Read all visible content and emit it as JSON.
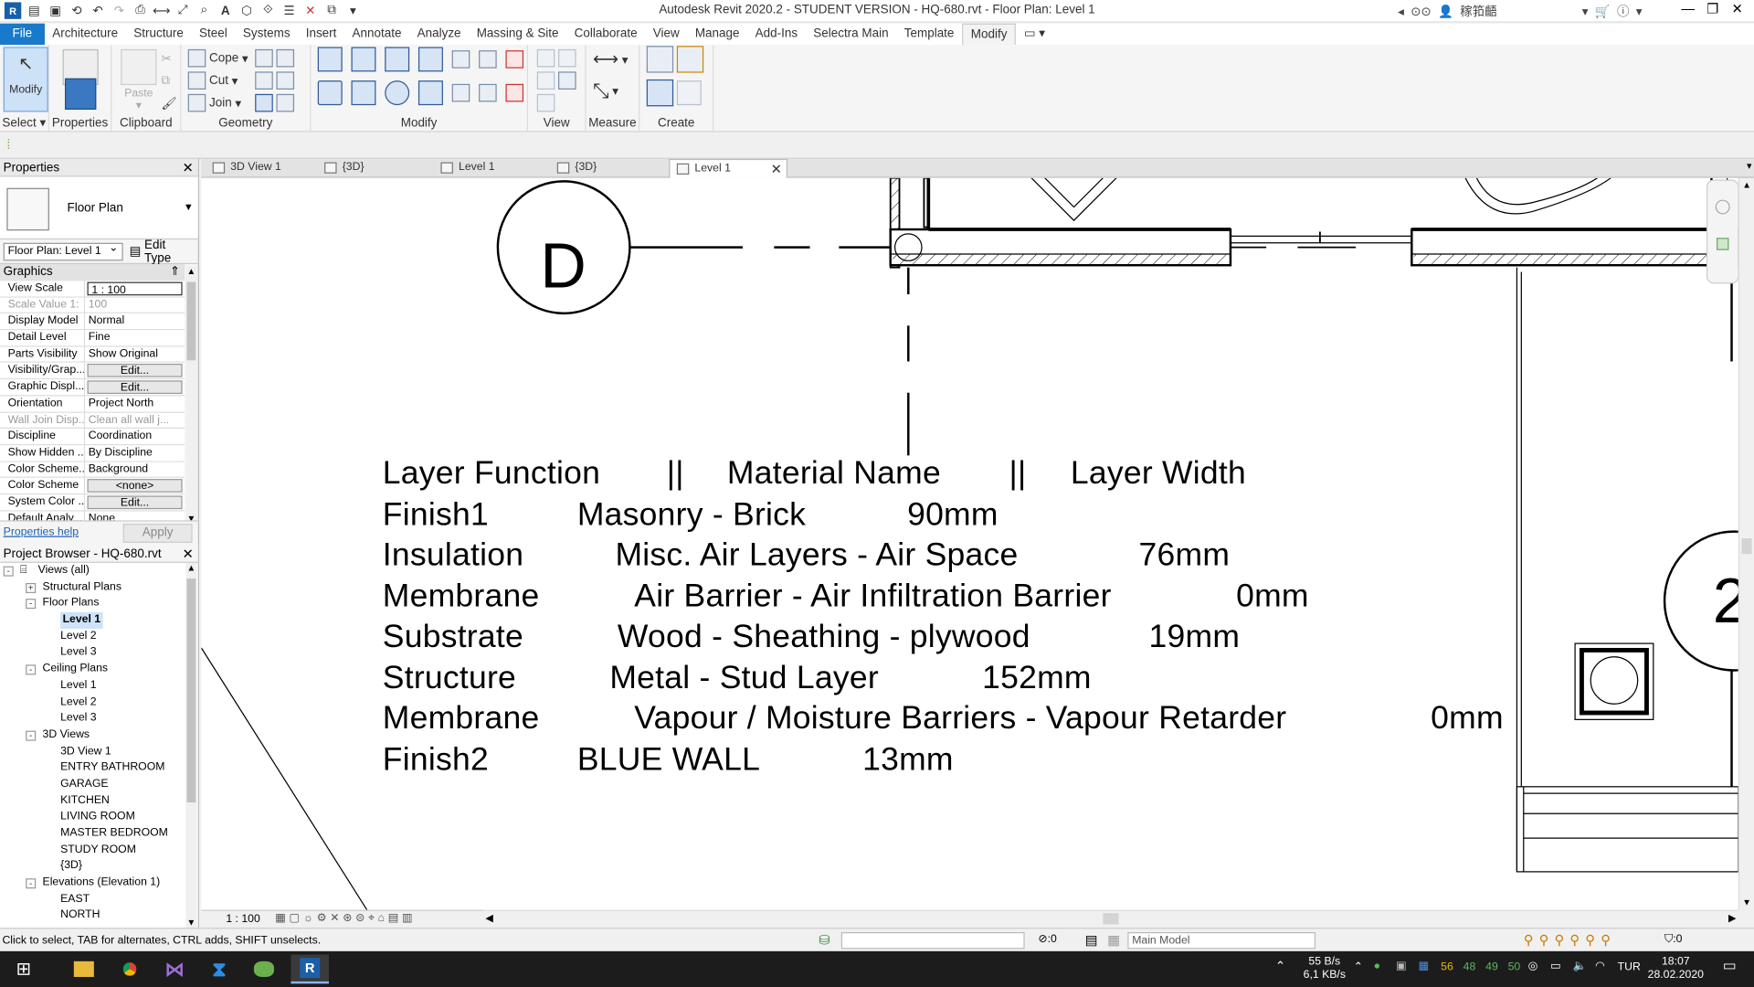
{
  "window": {
    "title": "Autodesk Revit 2020.2 - STUDENT VERSION - HQ-680.rvt - Floor Plan: Level 1",
    "user": "稼筘齬"
  },
  "menu": [
    "File",
    "Architecture",
    "Structure",
    "Steel",
    "Systems",
    "Insert",
    "Annotate",
    "Analyze",
    "Massing & Site",
    "Collaborate",
    "View",
    "Manage",
    "Add-Ins",
    "Selectra Main",
    "Template",
    "Modify"
  ],
  "ribbon": {
    "select": {
      "modify_label": "Modify",
      "panel": "Select"
    },
    "properties": {
      "label": "Properties"
    },
    "clipboard": {
      "paste": "Paste",
      "panel": "Clipboard"
    },
    "geometry": {
      "cope": "Cope",
      "cut": "Cut",
      "join": "Join",
      "panel": "Geometry"
    },
    "modify_panel": "Modify",
    "view_panel": "View",
    "measure_panel": "Measure",
    "create_panel": "Create"
  },
  "properties": {
    "header": "Properties",
    "type_name": "Floor Plan",
    "instance": "Floor Plan: Level 1",
    "edit_type": "Edit Type",
    "section": "Graphics",
    "rows": [
      {
        "name": "View Scale",
        "value": "1 : 100",
        "kind": "input"
      },
      {
        "name": "Scale Value    1:",
        "value": "100",
        "kind": "dim"
      },
      {
        "name": "Display Model",
        "value": "Normal"
      },
      {
        "name": "Detail Level",
        "value": "Fine"
      },
      {
        "name": "Parts Visibility",
        "value": "Show Original"
      },
      {
        "name": "Visibility/Grap...",
        "value": "Edit...",
        "kind": "btn"
      },
      {
        "name": "Graphic Displ...",
        "value": "Edit...",
        "kind": "btn"
      },
      {
        "name": "Orientation",
        "value": "Project North"
      },
      {
        "name": "Wall Join Disp...",
        "value": "Clean all wall j...",
        "kind": "dim"
      },
      {
        "name": "Discipline",
        "value": "Coordination"
      },
      {
        "name": "Show Hidden ...",
        "value": "By Discipline"
      },
      {
        "name": "Color Scheme...",
        "value": "Background"
      },
      {
        "name": "Color Scheme",
        "value": "<none>",
        "kind": "btn"
      },
      {
        "name": "System Color ...",
        "value": "Edit...",
        "kind": "btn"
      },
      {
        "name": "Default Analy...",
        "value": "None"
      }
    ],
    "help": "Properties help",
    "apply": "Apply"
  },
  "browser": {
    "header": "Project Browser - HQ-680.rvt",
    "nodes": [
      {
        "label": "Views (all)",
        "level": 0,
        "toggle": "-"
      },
      {
        "label": "Structural Plans",
        "level": 1,
        "toggle": "+"
      },
      {
        "label": "Floor Plans",
        "level": 1,
        "toggle": "-"
      },
      {
        "label": "Level 1",
        "level": 2,
        "selected": true
      },
      {
        "label": "Level 2",
        "level": 2
      },
      {
        "label": "Level 3",
        "level": 2
      },
      {
        "label": "Ceiling Plans",
        "level": 1,
        "toggle": "-"
      },
      {
        "label": "Level 1",
        "level": 2
      },
      {
        "label": "Level 2",
        "level": 2
      },
      {
        "label": "Level 3",
        "level": 2
      },
      {
        "label": "3D Views",
        "level": 1,
        "toggle": "-"
      },
      {
        "label": "3D View 1",
        "level": 2
      },
      {
        "label": "ENTRY BATHROOM",
        "level": 2
      },
      {
        "label": "GARAGE",
        "level": 2
      },
      {
        "label": "KITCHEN",
        "level": 2
      },
      {
        "label": "LIVING ROOM",
        "level": 2
      },
      {
        "label": "MASTER BEDROOM",
        "level": 2
      },
      {
        "label": "STUDY ROOM",
        "level": 2
      },
      {
        "label": "{3D}",
        "level": 2
      },
      {
        "label": "Elevations (Elevation 1)",
        "level": 1,
        "toggle": "-"
      },
      {
        "label": "EAST",
        "level": 2
      },
      {
        "label": "NORTH",
        "level": 2
      }
    ]
  },
  "tabs": [
    {
      "label": "3D View 1"
    },
    {
      "label": "{3D}"
    },
    {
      "label": "Level 1"
    },
    {
      "label": "{3D}"
    },
    {
      "label": "Level 1",
      "active": true
    }
  ],
  "canvas": {
    "grid_bubble": "D",
    "grid_bubble_right": "2",
    "lines": [
      [
        "Layer Function",
        "||",
        "Material Name",
        "||",
        "Layer Width"
      ],
      [
        "Finish1",
        "Masonry - Brick",
        "90mm"
      ],
      [
        "Insulation",
        "Misc. Air Layers - Air Space",
        "76mm"
      ],
      [
        "Membrane",
        "Air Barrier - Air Infiltration Barrier",
        "0mm"
      ],
      [
        "Substrate",
        "Wood - Sheathing - plywood",
        "19mm"
      ],
      [
        "Structure",
        "Metal - Stud Layer",
        "152mm"
      ],
      [
        "Membrane",
        "Vapour / Moisture Barriers - Vapour Retarder",
        "0mm"
      ],
      [
        "Finish2",
        "BLUE WALL",
        "13mm"
      ]
    ]
  },
  "view_control": {
    "scale": "1 : 100"
  },
  "status": {
    "message": "Click to select, TAB for alternates, CTRL adds, SHIFT unselects.",
    "selection_count": ":0",
    "model": "Main Model",
    "filter_count": ":0"
  },
  "taskbar": {
    "net_up": "55 B/s",
    "net_down": "6,1 KB/s",
    "tray_nums": [
      "56",
      "48",
      "49",
      "50"
    ],
    "lang": "TUR",
    "time": "18:07",
    "date": "28.02.2020"
  }
}
